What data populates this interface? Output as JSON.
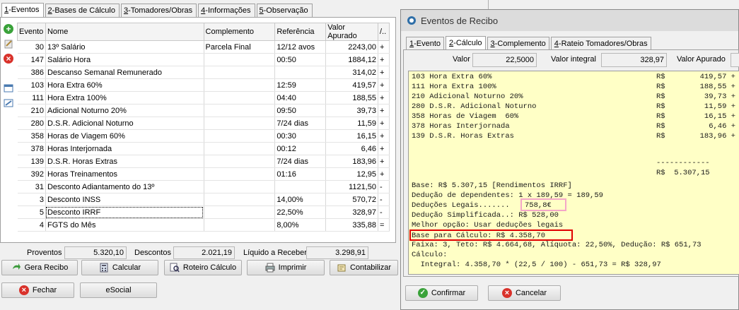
{
  "main": {
    "tabs": [
      {
        "key": "1",
        "label": "-Eventos"
      },
      {
        "key": "2",
        "label": "-Bases de Cálculo"
      },
      {
        "key": "3",
        "label": "-Tomadores/Obras"
      },
      {
        "key": "4",
        "label": "-Informações"
      },
      {
        "key": "5",
        "label": "-Observação"
      }
    ],
    "columns": [
      "Evento",
      "Nome",
      "Complemento",
      "Referência",
      "Valor Apurado",
      "/.."
    ],
    "rows": [
      {
        "evento": "30",
        "nome": "13º Salário",
        "complemento": "Parcela Final",
        "referencia": "12/12 avos",
        "valor": "2243,00",
        "sinal": "+"
      },
      {
        "evento": "147",
        "nome": "Salário Hora",
        "complemento": "",
        "referencia": "00:50",
        "valor": "1884,12",
        "sinal": "+"
      },
      {
        "evento": "386",
        "nome": "Descanso Semanal Remunerado",
        "complemento": "",
        "referencia": "",
        "valor": "314,02",
        "sinal": "+"
      },
      {
        "evento": "103",
        "nome": "Hora Extra 60%",
        "complemento": "",
        "referencia": "12:59",
        "valor": "419,57",
        "sinal": "+"
      },
      {
        "evento": "111",
        "nome": "Hora Extra 100%",
        "complemento": "",
        "referencia": "04:40",
        "valor": "188,55",
        "sinal": "+"
      },
      {
        "evento": "210",
        "nome": "Adicional Noturno 20%",
        "complemento": "",
        "referencia": "09:50",
        "valor": "39,73",
        "sinal": "+"
      },
      {
        "evento": "280",
        "nome": "D.S.R. Adicional Noturno",
        "complemento": "",
        "referencia": "7/24 dias",
        "valor": "11,59",
        "sinal": "+"
      },
      {
        "evento": "358",
        "nome": "Horas de Viagem  60%",
        "complemento": "",
        "referencia": "00:30",
        "valor": "16,15",
        "sinal": "+"
      },
      {
        "evento": "378",
        "nome": "Horas Interjornada",
        "complemento": "",
        "referencia": "00:12",
        "valor": "6,46",
        "sinal": "+"
      },
      {
        "evento": "139",
        "nome": "D.S.R. Horas Extras",
        "complemento": "",
        "referencia": "7/24 dias",
        "valor": "183,96",
        "sinal": "+"
      },
      {
        "evento": "392",
        "nome": "Horas Treinamentos",
        "complemento": "",
        "referencia": "01:16",
        "valor": "12,95",
        "sinal": "+"
      },
      {
        "evento": "31",
        "nome": "Desconto Adiantamento do 13º",
        "complemento": "",
        "referencia": "",
        "valor": "1121,50",
        "sinal": "-"
      },
      {
        "evento": "3",
        "nome": "Desconto INSS",
        "complemento": "",
        "referencia": "14,00%",
        "valor": "570,72",
        "sinal": "-"
      },
      {
        "evento": "5",
        "nome": "Desconto IRRF",
        "complemento": "",
        "referencia": "22,50%",
        "valor": "328,97",
        "sinal": "-"
      },
      {
        "evento": "4",
        "nome": "FGTS do Mês",
        "complemento": "",
        "referencia": "8,00%",
        "valor": "335,88",
        "sinal": "="
      }
    ],
    "totals": {
      "proventos_label": "Proventos",
      "proventos": "5.320,10",
      "descontos_label": "Descontos",
      "descontos": "2.021,19",
      "liquido_label": "Líquido a Receber",
      "liquido": "3.298,91"
    },
    "buttons": {
      "gera_recibo": "Gera Recibo",
      "calcular": "Calcular",
      "roteiro": "Roteiro Cálculo",
      "imprimir": "Imprimir",
      "contabilizar": "Contabilizar",
      "fechar": "Fechar",
      "esocial": "eSocial"
    }
  },
  "dialog": {
    "title": "Eventos de Recibo",
    "tabs": [
      {
        "key": "1",
        "label": "-Evento"
      },
      {
        "key": "2",
        "label": "-Cálculo"
      },
      {
        "key": "3",
        "label": "-Complemento"
      },
      {
        "key": "4",
        "label": "-Rateio Tomadores/Obras"
      }
    ],
    "valor_label": "Valor",
    "valor": "22,5000",
    "valor_integral_label": "Valor integral",
    "valor_integral": "328,97",
    "valor_apurado_label": "Valor Apurado",
    "calc_items": [
      {
        "desc": "103 Hora Extra 60%",
        "cur": "R$",
        "amt": "419,57 +"
      },
      {
        "desc": "111 Hora Extra 100%",
        "cur": "R$",
        "amt": "188,55 +"
      },
      {
        "desc": "210 Adicional Noturno 20%",
        "cur": "R$",
        "amt": "39,73 +"
      },
      {
        "desc": "280 D.S.R. Adicional Noturno",
        "cur": "R$",
        "amt": "11,59 +"
      },
      {
        "desc": "358 Horas de Viagem  60%",
        "cur": "R$",
        "amt": "16,15 +"
      },
      {
        "desc": "378 Horas Interjornada",
        "cur": "R$",
        "amt": "6,46 +"
      },
      {
        "desc": "139 D.S.R. Horas Extras",
        "cur": "R$",
        "amt": "183,96 +"
      }
    ],
    "calc_separator": "------------",
    "calc_total": "R$  5.307,15",
    "base_line": "Base: R$ 5.307,15 [Rendimentos IRRF]",
    "deducao_dependentes": "Dedução de dependentes: 1 x 189,59 = 189,59",
    "deducoes_legais_label": "Deduções Legais.......",
    "deducoes_legais_value": "758,8€",
    "deducao_simplificada": "Dedução Simplificada..: R$ 528,00",
    "melhor_opcao": "Melhor opção: Usar deduções legais",
    "base_calculo": "Base para Cálculo: R$ 4.358,70",
    "faixa": "Faixa: 3, Teto: R$ 4.664,68, Alíquota: 22,50%, Dedução: R$ 651,73",
    "calculo_label": "Cálculo:",
    "integral": "  Integral: 4.358,70 * (22,5 / 100) - 651,73 = R$ 328,97",
    "confirmar": "Confirmar",
    "cancelar": "Cancelar"
  },
  "colors": {
    "calc_bg": "#ffffc6",
    "highlight_red": "#e00000",
    "highlight_pink": "#f4a6c8"
  }
}
